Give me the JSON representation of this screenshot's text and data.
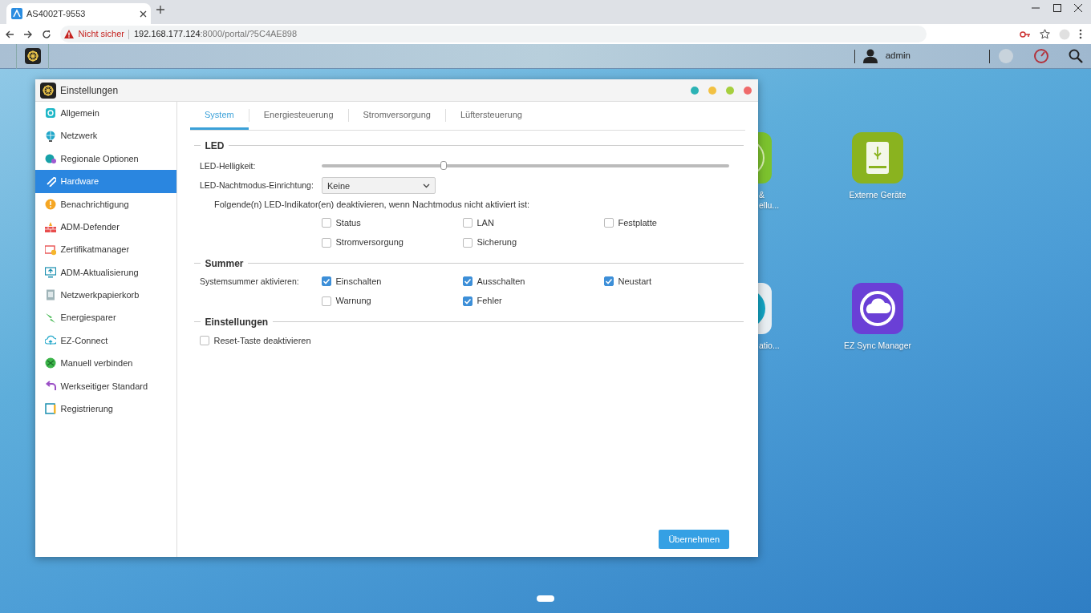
{
  "browser": {
    "tab": {
      "title": "AS4002T-9553"
    },
    "address": {
      "security": "Nicht sicher",
      "host": "192.168.177.124",
      "path": ":8000/portal/?5C4AE898"
    }
  },
  "topbar": {
    "user": "admin"
  },
  "desktop_icons": [
    {
      "kind": "disc",
      "lines": [
        "&",
        "ellu..."
      ],
      "partial": true
    },
    {
      "kind": "drive",
      "lines": [
        "Externe Geräte"
      ],
      "partial": false
    },
    {
      "kind": "gauge",
      "lines": [
        "atio..."
      ],
      "partial": true
    },
    {
      "kind": "sync",
      "lines": [
        "EZ Sync Manager"
      ],
      "partial": false
    }
  ],
  "window": {
    "title": "Einstellungen",
    "sidebar": [
      {
        "label": "Allgemein",
        "selected": false
      },
      {
        "label": "Netzwerk",
        "selected": false
      },
      {
        "label": "Regionale Optionen",
        "selected": false
      },
      {
        "label": "Hardware",
        "selected": true
      },
      {
        "label": "Benachrichtigung",
        "selected": false
      },
      {
        "label": "ADM-Defender",
        "selected": false
      },
      {
        "label": "Zertifikatmanager",
        "selected": false
      },
      {
        "label": "ADM-Aktualisierung",
        "selected": false
      },
      {
        "label": "Netzwerkpapierkorb",
        "selected": false
      },
      {
        "label": "Energiesparer",
        "selected": false
      },
      {
        "label": "EZ-Connect",
        "selected": false
      },
      {
        "label": "Manuell verbinden",
        "selected": false
      },
      {
        "label": "Werkseitiger Standard",
        "selected": false
      },
      {
        "label": "Registrierung",
        "selected": false
      }
    ],
    "tabs": [
      {
        "label": "System",
        "selected": true
      },
      {
        "label": "Energiesteuerung",
        "selected": false
      },
      {
        "label": "Stromversorgung",
        "selected": false
      },
      {
        "label": "Lüftersteuerung",
        "selected": false
      }
    ],
    "sections": [
      {
        "title": "LED",
        "rows": [
          {
            "kind": "slider",
            "label": "LED-Helligkeit:",
            "level": 0.3
          },
          {
            "kind": "select",
            "label": "LED-Nachtmodus-Einrichtung:",
            "value": "Keine"
          },
          {
            "kind": "note",
            "text": "Folgende(n) LED-Indikator(en) deaktivieren, wenn Nachtmodus nicht aktiviert ist:"
          },
          {
            "kind": "checks",
            "items": [
              {
                "label": "Status",
                "checked": false
              },
              {
                "label": "LAN",
                "checked": false
              },
              {
                "label": "Festplatte",
                "checked": false
              },
              {
                "label": "Stromversorgung",
                "checked": false
              },
              {
                "label": "Sicherung",
                "checked": false
              }
            ]
          }
        ]
      },
      {
        "title": "Summer",
        "rows": [
          {
            "kind": "checks",
            "label": "Systemsummer aktivieren:",
            "items": [
              {
                "label": "Einschalten",
                "checked": true
              },
              {
                "label": "Ausschalten",
                "checked": true
              },
              {
                "label": "Neustart",
                "checked": true
              },
              {
                "label": "Warnung",
                "checked": false
              },
              {
                "label": "Fehler",
                "checked": true
              }
            ]
          }
        ]
      },
      {
        "title": "Einstellungen",
        "rows": [
          {
            "kind": "check",
            "label": "Reset-Taste deaktivieren",
            "checked": false
          }
        ]
      }
    ],
    "apply_button": "Übernehmen"
  }
}
